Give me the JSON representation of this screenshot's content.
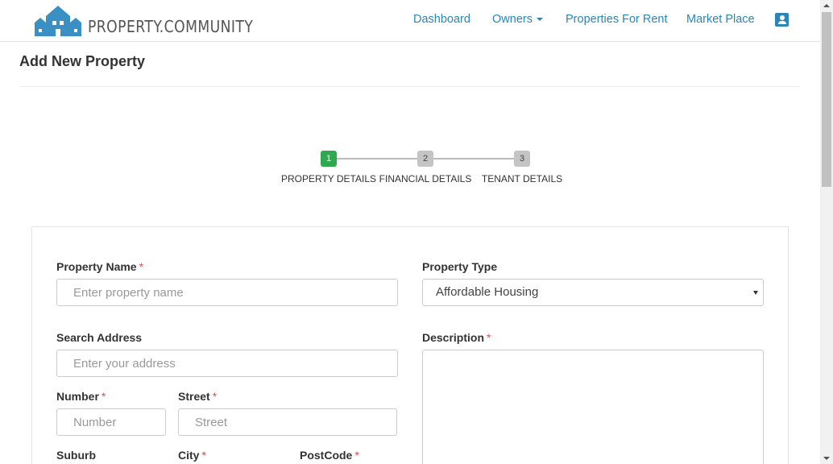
{
  "brand": {
    "name": "PROPERTY.COMMUNITY",
    "color": "#3a8fc3"
  },
  "nav": {
    "dashboard": "Dashboard",
    "owners": "Owners",
    "properties_for_rent": "Properties For Rent",
    "market_place": "Market Place",
    "profile_icon": "account-box-icon",
    "link_color": "#2a86b8"
  },
  "page": {
    "title": "Add New Property"
  },
  "stepper": {
    "steps": [
      {
        "number": "1",
        "label": "PROPERTY DETAILS",
        "state": "active"
      },
      {
        "number": "2",
        "label": "FINANCIAL DETAILS",
        "state": "inactive"
      },
      {
        "number": "3",
        "label": "TENANT DETAILS",
        "state": "inactive"
      }
    ],
    "active_color": "#2fa84f"
  },
  "form": {
    "property_name": {
      "label": "Property Name",
      "required": "*",
      "placeholder": "Enter property name",
      "value": ""
    },
    "property_type": {
      "label": "Property Type",
      "value": "Affordable Housing"
    },
    "search_address": {
      "label": "Search Address",
      "placeholder": "Enter your address",
      "value": ""
    },
    "description": {
      "label": "Description",
      "required": "*",
      "value": ""
    },
    "number": {
      "label": "Number",
      "required": "*",
      "placeholder": "Number",
      "value": ""
    },
    "street": {
      "label": "Street",
      "required": "*",
      "placeholder": "Street",
      "value": ""
    },
    "suburb": {
      "label": "Suburb"
    },
    "city": {
      "label": "City",
      "required": "*"
    },
    "postcode": {
      "label": "PostCode",
      "required": "*"
    }
  }
}
